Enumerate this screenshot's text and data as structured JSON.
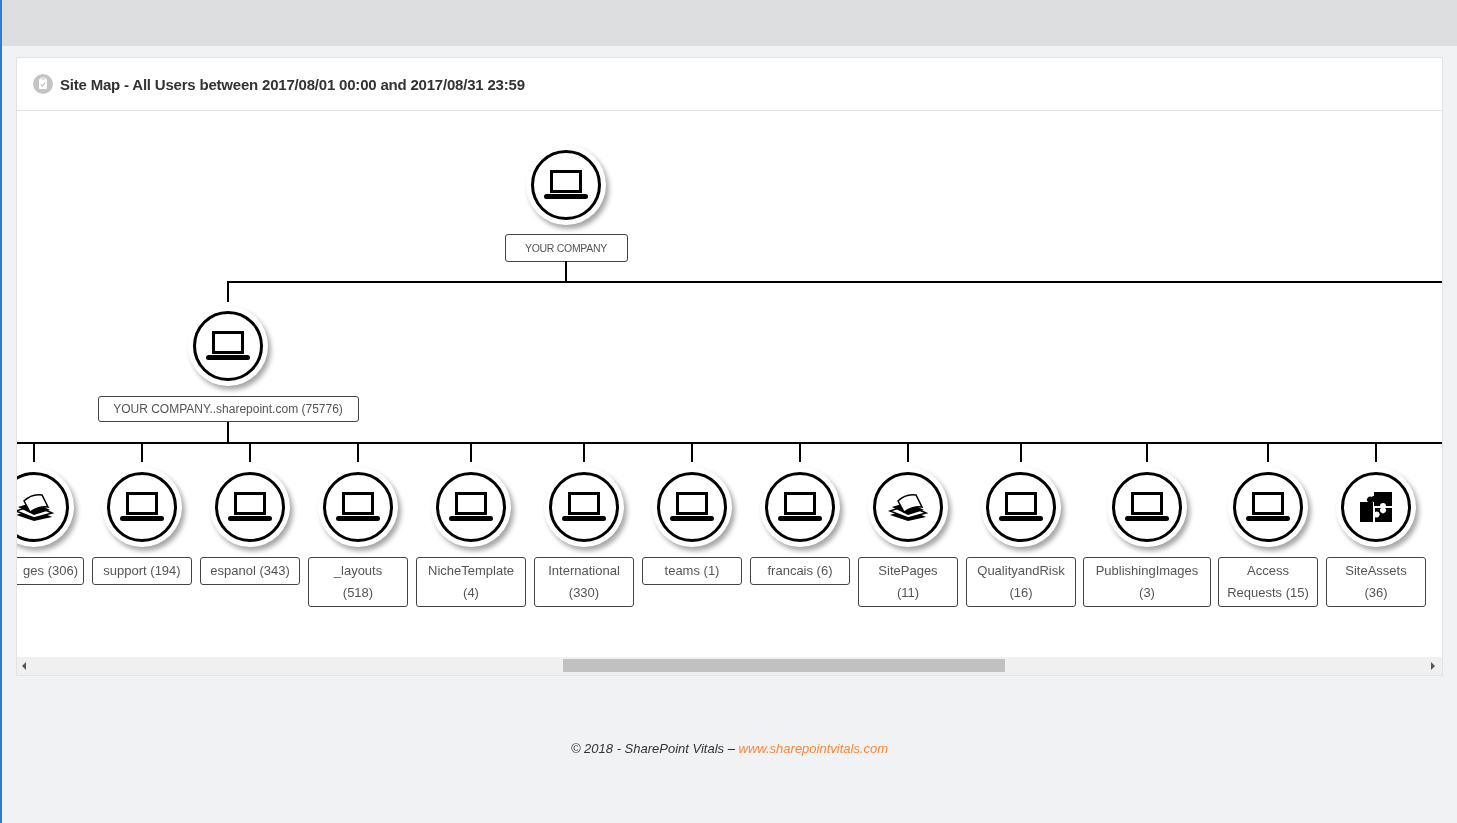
{
  "header": {
    "title": "Site Map - All Users between 2017/08/01 00:00 and 2017/08/31 23:59"
  },
  "sitemap": {
    "root": {
      "label": "YOUR COMPANY",
      "kind": "laptop",
      "children": [
        {
          "label": "YOUR COMPANY..sharepoint.com (75776)",
          "kind": "laptop",
          "children": [
            {
              "label": "ges (306)",
              "kind": "pages"
            },
            {
              "label": "support (194)",
              "kind": "laptop"
            },
            {
              "label": "espanol (343)",
              "kind": "laptop"
            },
            {
              "label": "_layouts (518)",
              "kind": "laptop"
            },
            {
              "label": "NicheTemplate (4)",
              "kind": "laptop"
            },
            {
              "label": "International (330)",
              "kind": "laptop"
            },
            {
              "label": "teams (1)",
              "kind": "laptop"
            },
            {
              "label": "francais (6)",
              "kind": "laptop"
            },
            {
              "label": "SitePages (11)",
              "kind": "pages"
            },
            {
              "label": "QualityandRisk (16)",
              "kind": "laptop"
            },
            {
              "label": "PublishingImages (3)",
              "kind": "laptop"
            },
            {
              "label": "Access Requests (15)",
              "kind": "laptop"
            },
            {
              "label": "SiteAssets (36)",
              "kind": "puzzle"
            }
          ]
        }
      ]
    }
  },
  "footer": {
    "text": "© 2018 - SharePoint Vitals –",
    "link": "www.sharepointvitals.com"
  }
}
